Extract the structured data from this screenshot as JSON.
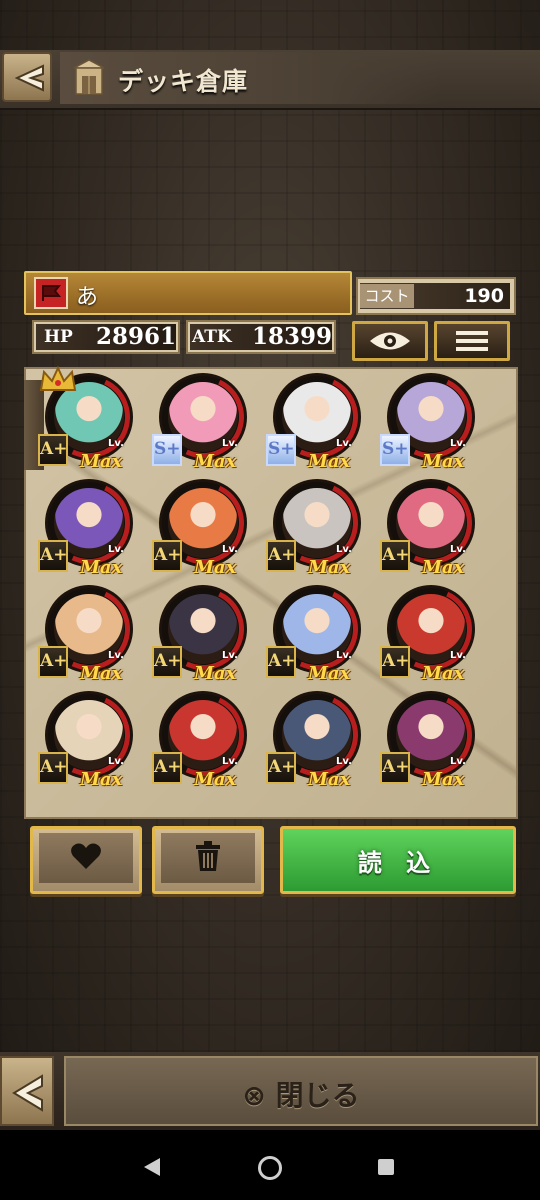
{
  "header": {
    "title": "デッキ倉庫"
  },
  "deck": {
    "name": "あ",
    "cost_label": "コスト",
    "cost_value": "190"
  },
  "stats": {
    "hp_label": "HP",
    "hp_value": "28961",
    "atk_label": "ATK",
    "atk_value": "18399"
  },
  "cards": [
    {
      "rank": "A+",
      "lv": "Lv.",
      "max": "Max",
      "color": "#6fc7b4"
    },
    {
      "rank": "S+",
      "lv": "Lv.",
      "max": "Max",
      "color": "#f29bb8"
    },
    {
      "rank": "S+",
      "lv": "Lv.",
      "max": "Max",
      "color": "#e9e9e9"
    },
    {
      "rank": "S+",
      "lv": "Lv.",
      "max": "Max",
      "color": "#b7a6d8"
    },
    {
      "rank": "A+",
      "lv": "Lv.",
      "max": "Max",
      "color": "#7a57b8"
    },
    {
      "rank": "A+",
      "lv": "Lv.",
      "max": "Max",
      "color": "#e87a45"
    },
    {
      "rank": "A+",
      "lv": "Lv.",
      "max": "Max",
      "color": "#c9c4c0"
    },
    {
      "rank": "A+",
      "lv": "Lv.",
      "max": "Max",
      "color": "#e06a82"
    },
    {
      "rank": "A+",
      "lv": "Lv.",
      "max": "Max",
      "color": "#e8b98a"
    },
    {
      "rank": "A+",
      "lv": "Lv.",
      "max": "Max",
      "color": "#3b3444"
    },
    {
      "rank": "A+",
      "lv": "Lv.",
      "max": "Max",
      "color": "#9fb7e8"
    },
    {
      "rank": "A+",
      "lv": "Lv.",
      "max": "Max",
      "color": "#c9392e"
    },
    {
      "rank": "A+",
      "lv": "Lv.",
      "max": "Max",
      "color": "#e6d4b8"
    },
    {
      "rank": "A+",
      "lv": "Lv.",
      "max": "Max",
      "color": "#c9362f"
    },
    {
      "rank": "A+",
      "lv": "Lv.",
      "max": "Max",
      "color": "#4a5878"
    },
    {
      "rank": "A+",
      "lv": "Lv.",
      "max": "Max",
      "color": "#8b3a6e"
    }
  ],
  "buttons": {
    "load": "読 込"
  },
  "footer": {
    "close_label": "⊗ 閉じる"
  },
  "icons": {
    "back": "chevron-left-icon",
    "deck_house": "storehouse-icon",
    "deck_flag": "flag-icon",
    "eye": "eye-icon",
    "menu": "menu-icon",
    "favorite": "heart-icon",
    "delete": "trash-icon",
    "crown": "crown-icon"
  }
}
